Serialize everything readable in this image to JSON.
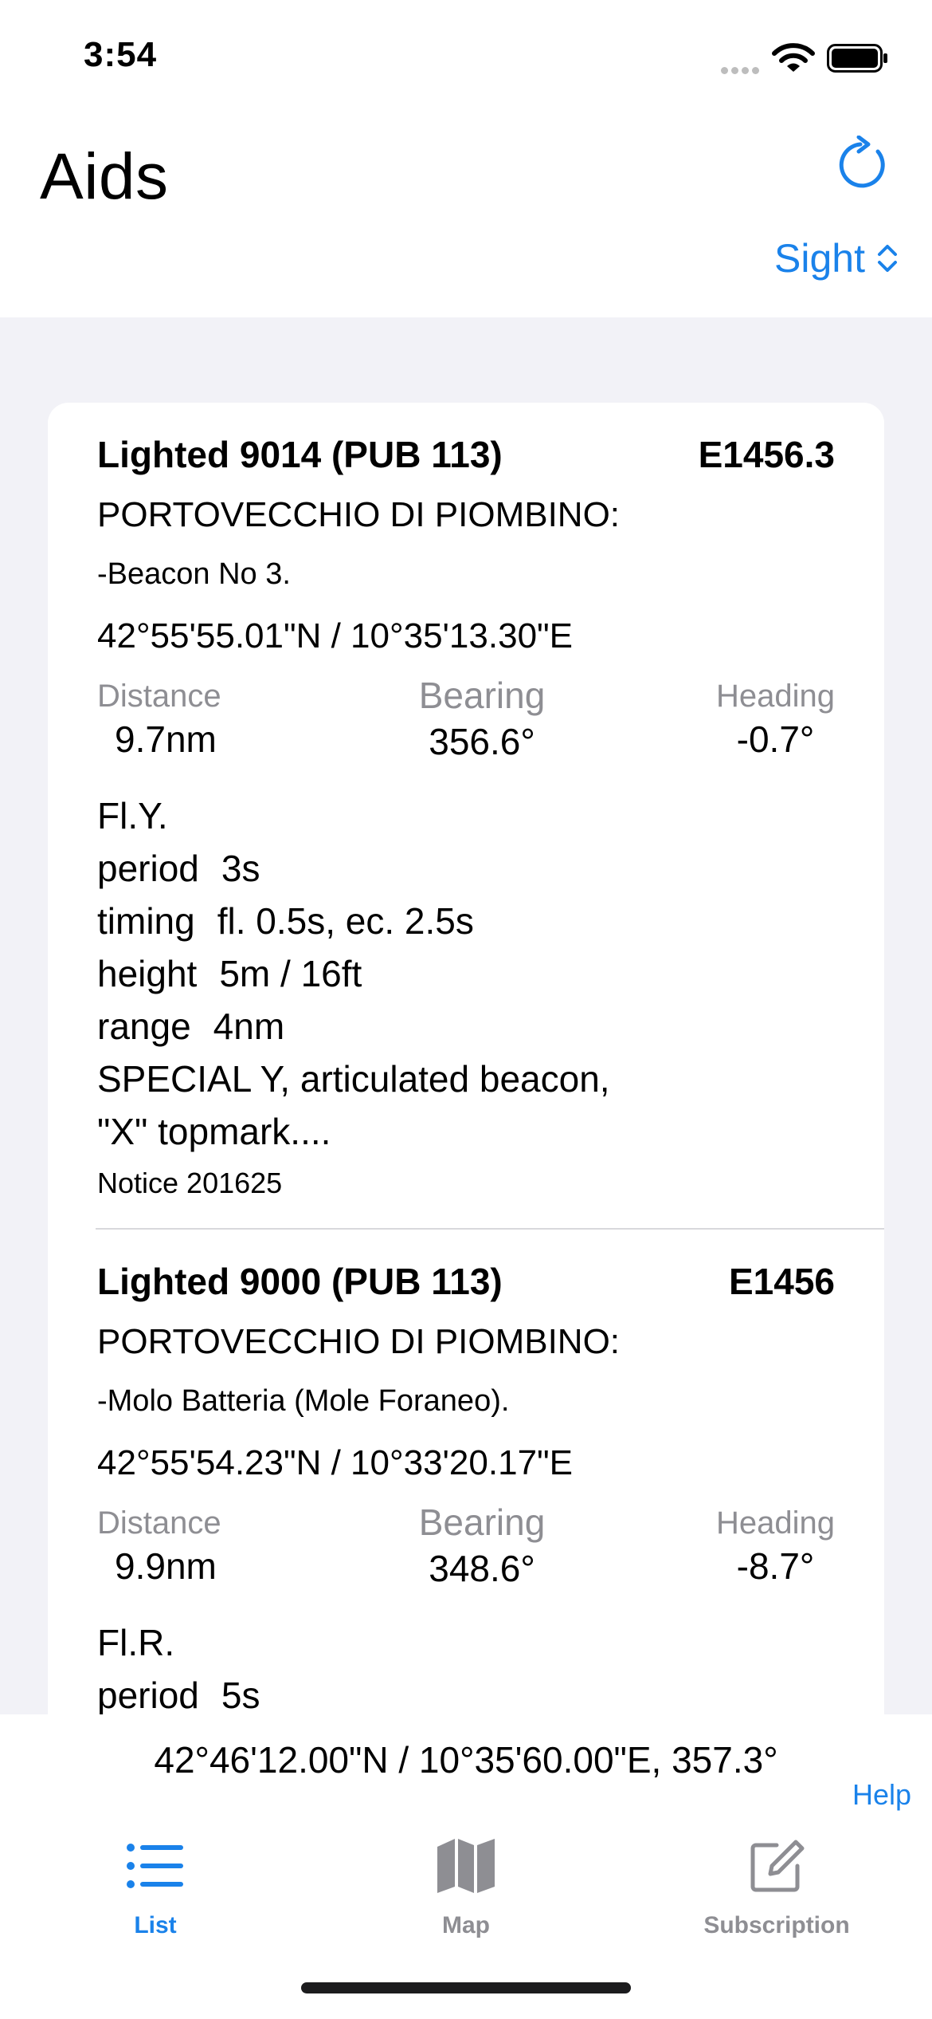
{
  "status_bar": {
    "time": "3:54"
  },
  "header": {
    "title": "Aids",
    "sort_label": "Sight"
  },
  "aids": [
    {
      "title": "Lighted 9014 (PUB 113)",
      "id": "E1456.3",
      "location": "PORTOVECCHIO DI PIOMBINO:",
      "sublocation": "-Beacon No 3.",
      "coords": "42°55'55.01\"N / 10°35'13.30\"E",
      "distance_label": "Distance",
      "distance": "9.7nm",
      "bearing_label": "Bearing",
      "bearing": "356.6°",
      "heading_label": "Heading",
      "heading": "-0.7°",
      "characteristic": "Fl.Y.",
      "period_label": "period",
      "period": "3s",
      "timing_label": "timing",
      "timing": "fl. 0.5s, ec. 2.5s",
      "height_label": "height",
      "height": "5m / 16ft",
      "range_label": "range",
      "range": "4nm",
      "remarks_1": "SPECIAL Y, articulated beacon,",
      "remarks_2": "\"X\" topmark....",
      "notice": "Notice 201625"
    },
    {
      "title": "Lighted 9000 (PUB 113)",
      "id": "E1456",
      "location": "PORTOVECCHIO DI PIOMBINO:",
      "sublocation": "-Molo Batteria (Mole Foraneo).",
      "coords": "42°55'54.23\"N / 10°33'20.17\"E",
      "distance_label": "Distance",
      "distance": "9.9nm",
      "bearing_label": "Bearing",
      "bearing": "348.6°",
      "heading_label": "Heading",
      "heading": "-8.7°",
      "characteristic": "Fl.R.",
      "period_label": "period",
      "period": "5s"
    }
  ],
  "footer": {
    "current_position": "42°46'12.00\"N / 10°35'60.00\"E, 357.3°",
    "help_label": "Help"
  },
  "tabs": [
    {
      "label": "List",
      "icon": "list-icon",
      "active": true
    },
    {
      "label": "Map",
      "icon": "map-icon",
      "active": false
    },
    {
      "label": "Subscription",
      "icon": "edit-icon",
      "active": false
    }
  ],
  "colors": {
    "accent": "#1A82EA",
    "secondary_text": "#8E8E93",
    "background": "#F2F2F7"
  }
}
